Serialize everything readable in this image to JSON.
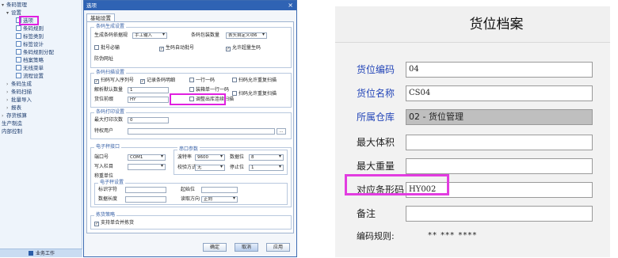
{
  "tree": {
    "items": [
      {
        "label": "条码管理",
        "arrow": "▾",
        "icon": false
      },
      {
        "label": "设置",
        "arrow": "▾",
        "icon": false
      },
      {
        "label": "选项",
        "arrow": "",
        "icon": true
      },
      {
        "label": "条码规则",
        "arrow": "",
        "icon": true
      },
      {
        "label": "标签类别",
        "arrow": "",
        "icon": true
      },
      {
        "label": "标签设计",
        "arrow": "",
        "icon": true
      },
      {
        "label": "条码规则分配",
        "arrow": "",
        "icon": true
      },
      {
        "label": "档案策略",
        "arrow": "",
        "icon": true
      },
      {
        "label": "无线菜单",
        "arrow": "",
        "icon": true
      },
      {
        "label": "流程设置",
        "arrow": "",
        "icon": true
      },
      {
        "label": "条码生成",
        "arrow": "›",
        "icon": false
      },
      {
        "label": "条码扫描",
        "arrow": "›",
        "icon": false
      },
      {
        "label": "批量导入",
        "arrow": "›",
        "icon": false
      },
      {
        "label": "报表",
        "arrow": "›",
        "icon": false
      },
      {
        "label": "存货核算",
        "arrow": "›",
        "icon": false
      },
      {
        "label": "生产制造",
        "arrow": "",
        "icon": false
      },
      {
        "label": "内部控制",
        "arrow": "",
        "icon": false
      }
    ],
    "footer": "业务工作"
  },
  "dialog": {
    "title": "选项",
    "close": "×",
    "tab": "基础设置",
    "g1": {
      "title": "条码生成设置",
      "rule_label": "生成条码依据规",
      "rule_value": "手工输入",
      "qty_label": "条码包装数量",
      "qty_value": "表头自定义项6",
      "chk_batch": "批号必输",
      "chk_auto": "生码自动批号",
      "chk_dup": "允许超量生码",
      "anti_label": "防伪网址"
    },
    "g2": {
      "title": "条码扫描设置",
      "chk_scan": "扫码写入序列号",
      "chk_record": "记录条码明细",
      "chk_one": "一行一码",
      "chk_allow": "扫码允许重复扫描",
      "parse_label": "解析默认数量",
      "parse_value": "1",
      "chk_box": "装箱单一行一码",
      "pos_label": "货位前缀",
      "pos_value": "HY",
      "chk_dup_scan": "扫码允许重复扫描",
      "chk_save": "调整出库连续扫描"
    },
    "g3": {
      "title": "条码打印设置",
      "max_label": "最大打印次数",
      "max_value": "0",
      "user_label": "特权用户",
      "more": "..."
    },
    "g4": {
      "title": "电子秤接口",
      "port_label": "端口号",
      "port_value": "COM1",
      "write_label": "写入栏目",
      "weigh_label": "称重单位",
      "param_title": "串口参数",
      "baud_label": "波特率",
      "baud_value": "9600",
      "data_label": "数据位",
      "data_value": "8",
      "check_label": "校验方式",
      "check_value": "无",
      "stop_label": "停止位",
      "stop_value": "1",
      "scale_title": "电子秤设置",
      "mark_label": "标识字符",
      "start_label": "起始位",
      "len_label": "数据长度",
      "dir_label": "读取方向",
      "dir_value": "正向"
    },
    "g5": {
      "title": "拣货策略",
      "chk_merge": "支持单合并拣货"
    },
    "ok": "确定",
    "cancel": "取消",
    "apply": "应用"
  },
  "form": {
    "title": "货位档案",
    "fields": [
      {
        "label": "货位编码",
        "value": "04",
        "blue": true
      },
      {
        "label": "货位名称",
        "value": "CS04",
        "blue": true
      },
      {
        "label": "所属仓库",
        "value": "02 - 货位管理",
        "blue": true
      },
      {
        "label": "最大体积",
        "value": "",
        "blue": false
      },
      {
        "label": "最大重量",
        "value": "",
        "blue": false
      },
      {
        "label": "对应条形码",
        "value": "HY002",
        "blue": false
      },
      {
        "label": "备注",
        "value": "",
        "blue": false
      }
    ],
    "rule_label": "编码规则:",
    "rule_value": "** *** ****"
  }
}
